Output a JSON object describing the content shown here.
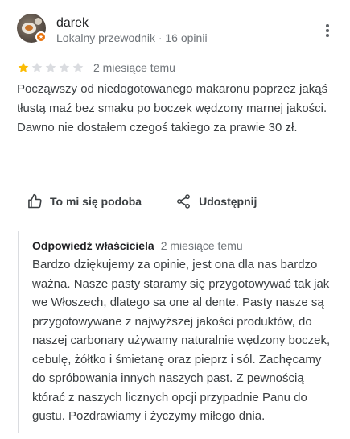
{
  "review": {
    "author": "darek",
    "author_meta": "Lokalny przewodnik · 16 opinii",
    "rating": 1,
    "rating_max": 5,
    "time": "2 miesiące temu",
    "text": "Począwszy od niedogotowanego makaronu poprzez jakąś tłustą maź bez smaku po boczek wędzony marnej jakości. Dawno nie dostałem czegoś takiego za prawie 30 zł."
  },
  "actions": {
    "like_label": "To mi się podoba",
    "share_label": "Udostępnij"
  },
  "owner_reply": {
    "title": "Odpowiedź właściciela",
    "time": "2 miesiące temu",
    "text": "Bardzo dziękujemy za opinie, jest ona dla nas bardzo ważna. Nasze pasty staramy się przygotowywać tak jak we Włoszech, dlatego sa one al dente. Pasty nasze są przygotowywane z najwyższej jakości produktów, do naszej carbonary używamy naturalnie wędzony boczek, cebulę,  żółtko i śmietanę oraz pieprz i sól. Zachęcamy do spróbowania innych naszych past. Z pewnością którać z naszych licznych opcji przypadnie Panu do gustu. Pozdrawiamy i życzymy miłego dnia."
  },
  "colors": {
    "star_filled": "#fbbc04",
    "star_empty": "#dadce0",
    "badge": "#e8710a"
  },
  "icons": {
    "menu": "more-vert-icon",
    "like": "thumb-up-icon",
    "share": "share-icon",
    "badge": "local-guide-badge-icon"
  }
}
